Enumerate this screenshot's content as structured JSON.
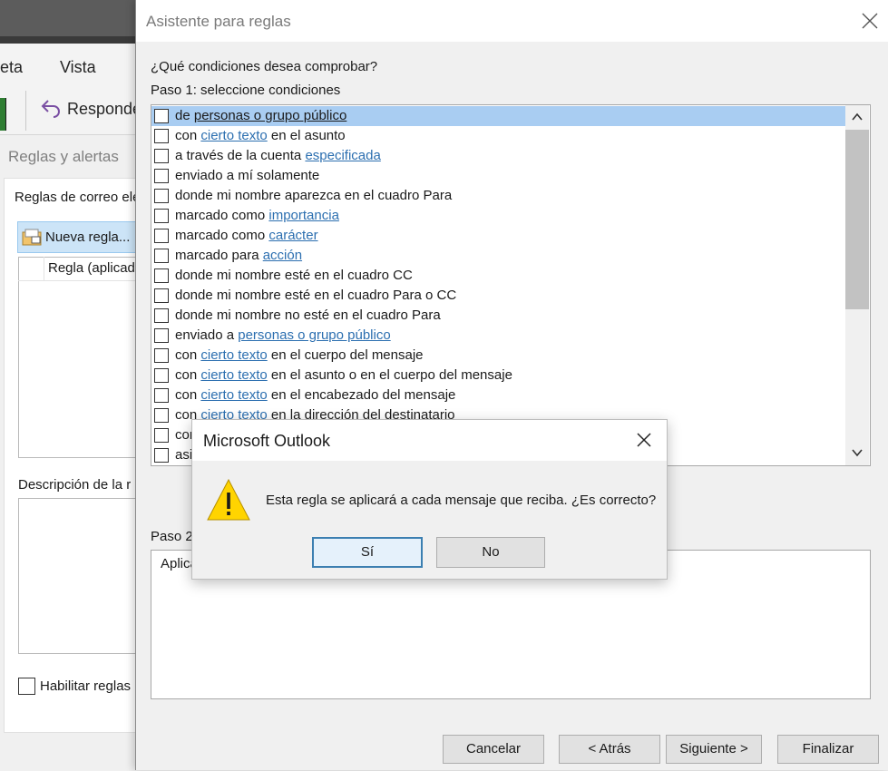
{
  "background": {
    "menu": {
      "carpeta": "eta",
      "vista": "Vista"
    },
    "ribbon": {
      "reply_label": "Responde"
    },
    "rules_dialog": {
      "title": "Reglas y alertas",
      "email_rules_label": "Reglas de correo ele",
      "new_rule_label": "Nueva regla...",
      "column_header": "Regla (aplicad",
      "description_label": "Descripción de la r",
      "enable_label": "Habilitar reglas"
    }
  },
  "wizard": {
    "title": "Asistente para reglas",
    "question": "¿Qué condiciones desea comprobar?",
    "step1": "Paso 1: seleccione condiciones",
    "conditions": [
      {
        "pre": "de ",
        "link": "personas o grupo público",
        "post": "",
        "selected": true
      },
      {
        "pre": "con ",
        "link": "cierto texto",
        "post": " en el asunto"
      },
      {
        "pre": "a través de la cuenta ",
        "link": "especificada",
        "post": ""
      },
      {
        "pre": "enviado a mí solamente",
        "link": "",
        "post": ""
      },
      {
        "pre": "donde mi nombre aparezca en el cuadro Para",
        "link": "",
        "post": ""
      },
      {
        "pre": "marcado como ",
        "link": "importancia",
        "post": ""
      },
      {
        "pre": "marcado como ",
        "link": "carácter",
        "post": ""
      },
      {
        "pre": "marcado para ",
        "link": "acción",
        "post": ""
      },
      {
        "pre": "donde mi nombre esté en el cuadro CC",
        "link": "",
        "post": ""
      },
      {
        "pre": "donde mi nombre esté en el cuadro Para o CC",
        "link": "",
        "post": ""
      },
      {
        "pre": "donde mi nombre no esté en el cuadro Para",
        "link": "",
        "post": ""
      },
      {
        "pre": "enviado a ",
        "link": "personas o grupo público",
        "post": ""
      },
      {
        "pre": "con ",
        "link": "cierto texto",
        "post": " en el cuerpo del mensaje"
      },
      {
        "pre": "con ",
        "link": "cierto texto",
        "post": " en el asunto o en el cuerpo del mensaje"
      },
      {
        "pre": "con ",
        "link": "cierto texto",
        "post": " en el encabezado del mensaje"
      },
      {
        "pre": "con ",
        "link": "cierto texto",
        "post": " en la dirección del destinatario"
      },
      {
        "pre": "con",
        "link": "",
        "post": ""
      },
      {
        "pre": "asi",
        "link": "",
        "post": ""
      }
    ],
    "step2": "Paso 2:",
    "step2_text": "Aplica",
    "buttons": {
      "cancel": "Cancelar",
      "back": "< Atrás",
      "next": "Siguiente >",
      "finish": "Finalizar"
    }
  },
  "msgbox": {
    "title": "Microsoft Outlook",
    "message": "Esta regla se aplicará a cada mensaje que reciba. ¿Es correcto?",
    "yes": "Sí",
    "no": "No"
  },
  "colors": {
    "link": "#2c6fb0",
    "selection": "#a9cdf2",
    "warning": "#ffd400"
  },
  "icons": [
    "reply-icon",
    "new-rule-icon",
    "close-icon",
    "scroll-up-icon",
    "scroll-down-icon",
    "warning-icon"
  ]
}
